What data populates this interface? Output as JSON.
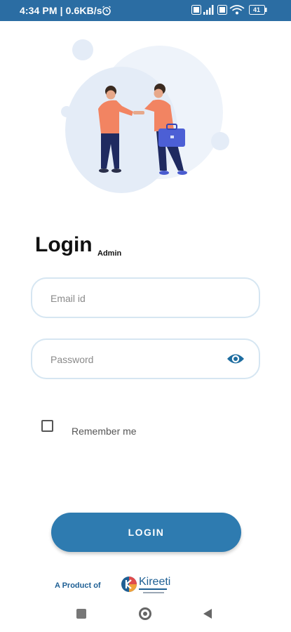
{
  "status_bar": {
    "time": "4:34 PM | 0.6KB/s",
    "battery": "41",
    "icons": [
      "alarm-icon",
      "volte-icon",
      "signal-icon",
      "wifi-icon",
      "battery-icon"
    ]
  },
  "login": {
    "title": "Login",
    "subtitle": "Admin",
    "email_placeholder": "Email id",
    "email_value": "",
    "password_placeholder": "Password",
    "password_value": "",
    "remember_label": "Remember me",
    "remember_checked": false,
    "button_label": "LOGIN"
  },
  "footer": {
    "product_label": "A Product of",
    "brand_name": "Kireeti"
  },
  "colors": {
    "primary": "#2e7bb0",
    "status_bar": "#2b6da3",
    "field_border": "#d6e6f2"
  }
}
